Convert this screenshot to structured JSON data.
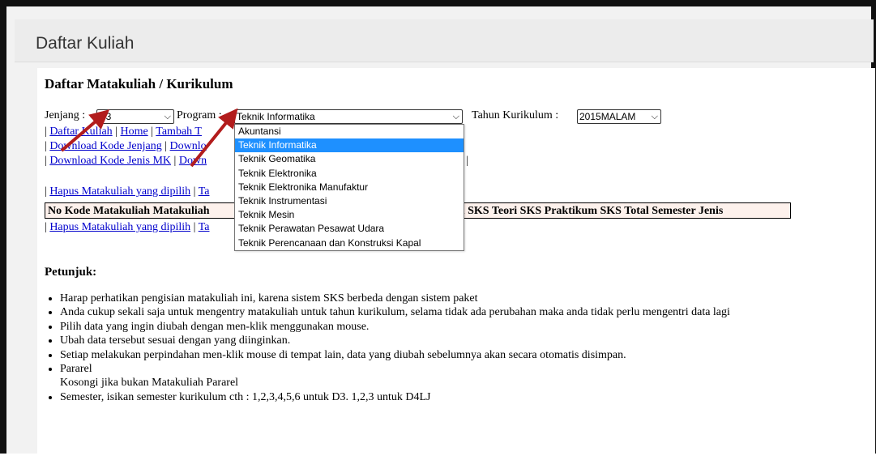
{
  "page_title": "Daftar Kuliah",
  "section_title": "Daftar Matakuliah / Kurikulum",
  "filters": {
    "jenjang_label": "Jenjang :",
    "jenjang_value": "D3",
    "program_label": "Program :",
    "program_value": "Teknik Informatika",
    "tahun_label": "Tahun Kurikulum :",
    "tahun_value": "2015MALAM"
  },
  "link_rows": [
    {
      "prefix": "| ",
      "links": [
        "Daftar Kuliah",
        "Home",
        "Tambah T"
      ],
      "seps": [
        " | ",
        " | "
      ]
    },
    {
      "prefix": "| ",
      "links": [
        "Download Kode Jenjang",
        "Downlo"
      ],
      "seps": [
        " | "
      ]
    },
    {
      "prefix": "| ",
      "links": [
        "Download Kode Jenis MK",
        "Down"
      ],
      "seps": [
        " | "
      ],
      "tail": "|"
    }
  ],
  "action_links_top": {
    "prefix": "| ",
    "hapus": "Hapus Matakuliah yang dipilih",
    "sep": " | ",
    "partial": "Ta"
  },
  "action_links_bottom": {
    "prefix": "| ",
    "hapus": "Hapus Matakuliah yang dipilih",
    "sep": " | ",
    "partial": "Ta"
  },
  "table_header": {
    "left": "No Kode Matakuliah Matakuliah",
    "right": "Total SKS Teori SKS Praktikum SKS Total Semester Jenis"
  },
  "program_options": [
    "Akuntansi",
    "Teknik Informatika",
    "Teknik Geomatika",
    "Teknik Elektronika",
    "Teknik Elektronika Manufaktur",
    "Teknik Instrumentasi",
    "Teknik Mesin",
    "Teknik Perawatan Pesawat Udara",
    "Teknik Perencanaan dan Konstruksi Kapal"
  ],
  "selected_option_index": 1,
  "petunjuk_title": "Petunjuk:",
  "tips": [
    "Harap perhatikan pengisian matakuliah ini, karena sistem SKS berbeda dengan sistem paket",
    "Anda cukup sekali saja untuk mengentry matakuliah untuk tahun kurikulum, selama tidak ada perubahan maka anda tidak perlu mengentri data lagi",
    "Pilih data yang ingin diubah dengan men-klik menggunakan mouse.",
    "Ubah data tersebut sesuai dengan yang diinginkan.",
    "Setiap melakukan perpindahan men-klik mouse di tempat lain, data yang diubah sebelumnya akan secara otomatis disimpan.",
    "Pararel",
    "Semester, isikan semester kurikulum cth : 1,2,3,4,5,6 untuk D3. 1,2,3 untuk D4LJ"
  ],
  "tip_pararel_note": "Kosongi jika bukan Matakuliah Pararel",
  "colors": {
    "link": "#0000cc",
    "arrow": "#b21c1c",
    "selected_option": "#1e90ff",
    "header_row_bg": "#fdf1ec"
  }
}
